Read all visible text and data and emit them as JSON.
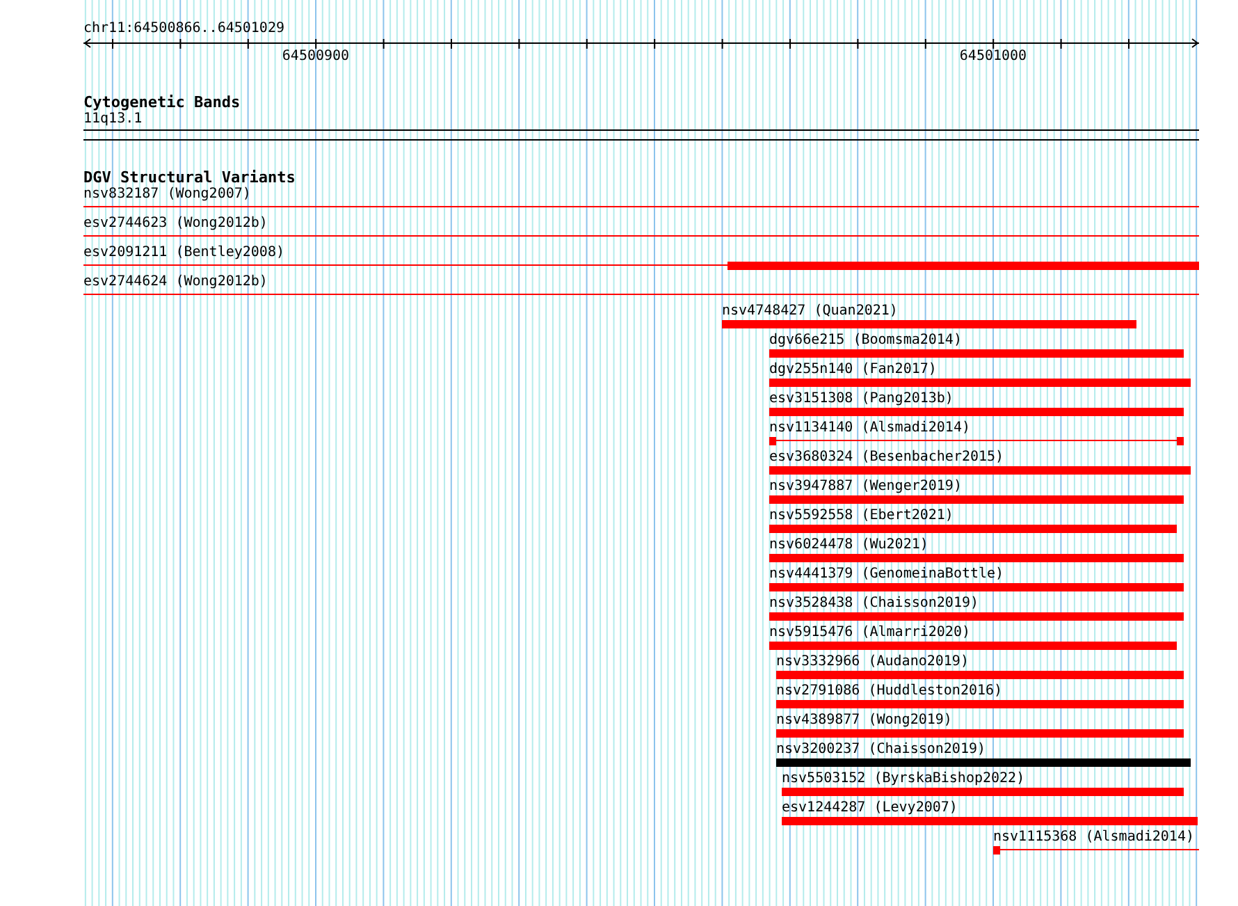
{
  "location": "chr11:64500866..64501029",
  "axis": {
    "ticks": [
      "64500900",
      "64501000"
    ]
  },
  "tracks": [
    {
      "title": "Cytogenetic Bands",
      "kind": "bands",
      "label": "11q13.1"
    },
    {
      "title": "DGV Structural Variants",
      "kind": "variants",
      "features": [
        {
          "label": "nsv832187 (Wong2007)",
          "kind": "line",
          "color": "#ff0000"
        },
        {
          "label": "esv2744623 (Wong2012b)",
          "kind": "line",
          "color": "#ff0000"
        },
        {
          "label": "esv2091211 (Bentley2008)",
          "kind": "partial",
          "color": "#ff0000"
        },
        {
          "label": "esv2744624 (Wong2012b)",
          "kind": "line",
          "color": "#ff0000"
        },
        {
          "label": "nsv4748427 (Quan2021)",
          "kind": "bar",
          "color": "#ff0000"
        },
        {
          "label": "dgv66e215 (Boomsma2014)",
          "kind": "bar",
          "color": "#ff0000"
        },
        {
          "label": "dgv255n140 (Fan2017)",
          "kind": "bar",
          "color": "#ff0000"
        },
        {
          "label": "esv3151308 (Pang2013b)",
          "kind": "bar",
          "color": "#ff0000"
        },
        {
          "label": "nsv1134140 (Alsmadi2014)",
          "kind": "gapped",
          "color": "#ff0000"
        },
        {
          "label": "esv3680324 (Besenbacher2015)",
          "kind": "bar",
          "color": "#ff0000"
        },
        {
          "label": "nsv3947887 (Wenger2019)",
          "kind": "bar",
          "color": "#ff0000"
        },
        {
          "label": "nsv5592558 (Ebert2021)",
          "kind": "bar",
          "color": "#ff0000"
        },
        {
          "label": "nsv6024478 (Wu2021)",
          "kind": "bar",
          "color": "#ff0000"
        },
        {
          "label": "nsv4441379 (GenomeinaBottle)",
          "kind": "bar",
          "color": "#ff0000"
        },
        {
          "label": "nsv3528438 (Chaisson2019)",
          "kind": "bar",
          "color": "#ff0000"
        },
        {
          "label": "nsv5915476 (Almarri2020)",
          "kind": "bar",
          "color": "#ff0000"
        },
        {
          "label": "nsv3332966 (Audano2019)",
          "kind": "bar",
          "color": "#ff0000"
        },
        {
          "label": "nsv2791086 (Huddleston2016)",
          "kind": "bar",
          "color": "#ff0000"
        },
        {
          "label": "nsv4389877 (Wong2019)",
          "kind": "bar",
          "color": "#ff0000"
        },
        {
          "label": "nsv3200237 (Chaisson2019)",
          "kind": "bar",
          "color": "#000000"
        },
        {
          "label": "nsv5503152 (ByrskaBishop2022)",
          "kind": "bar",
          "color": "#ff0000"
        },
        {
          "label": "esv1244287 (Levy2007)",
          "kind": "bar",
          "color": "#ff0000"
        },
        {
          "label": "nsv1115368 (Alsmadi2014)",
          "kind": "open-end",
          "color": "#ff0000"
        }
      ]
    }
  ]
}
